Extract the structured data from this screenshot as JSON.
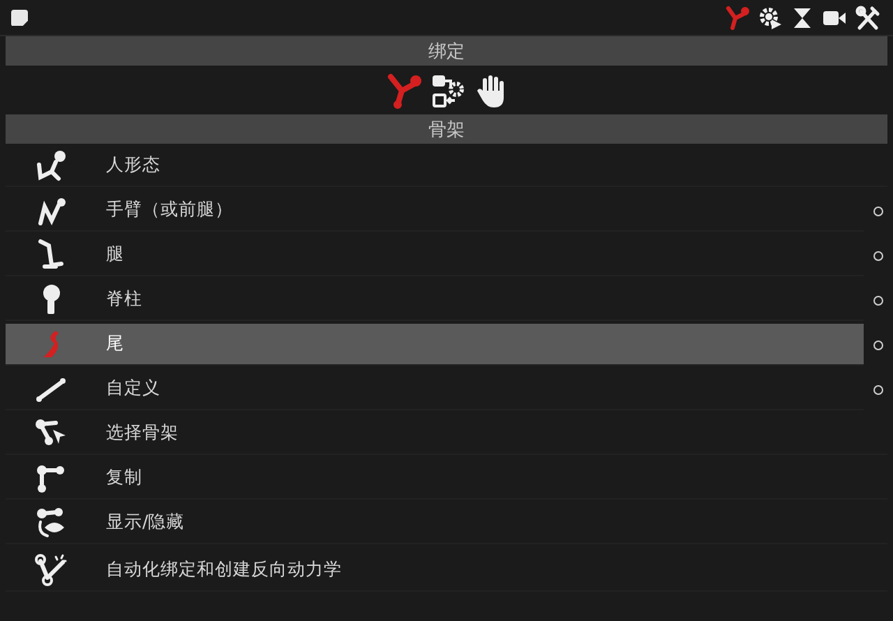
{
  "toolbar": {
    "tools": [
      {
        "selected": true
      },
      {
        "selected": false
      },
      {
        "selected": false
      },
      {
        "selected": false
      },
      {
        "selected": false
      }
    ]
  },
  "rig_section": {
    "title": "绑定",
    "modes": [
      {
        "selected": true
      },
      {
        "selected": false
      },
      {
        "selected": false
      }
    ]
  },
  "skeleton_section": {
    "title": "骨架",
    "items": [
      {
        "label": "人形态",
        "selected": false,
        "has_option": false
      },
      {
        "label": "手臂（或前腿）",
        "selected": false,
        "has_option": true
      },
      {
        "label": "腿",
        "selected": false,
        "has_option": true
      },
      {
        "label": "脊柱",
        "selected": false,
        "has_option": true
      },
      {
        "label": "尾",
        "selected": true,
        "has_option": true
      },
      {
        "label": "自定义",
        "selected": false,
        "has_option": true
      },
      {
        "label": "选择骨架",
        "selected": false,
        "has_option": false
      },
      {
        "label": "复制",
        "selected": false,
        "has_option": false
      },
      {
        "label": "显示/隐藏",
        "selected": false,
        "has_option": false
      },
      {
        "label": "自动化绑定和创建反向动力学",
        "selected": false,
        "has_option": false
      }
    ]
  }
}
